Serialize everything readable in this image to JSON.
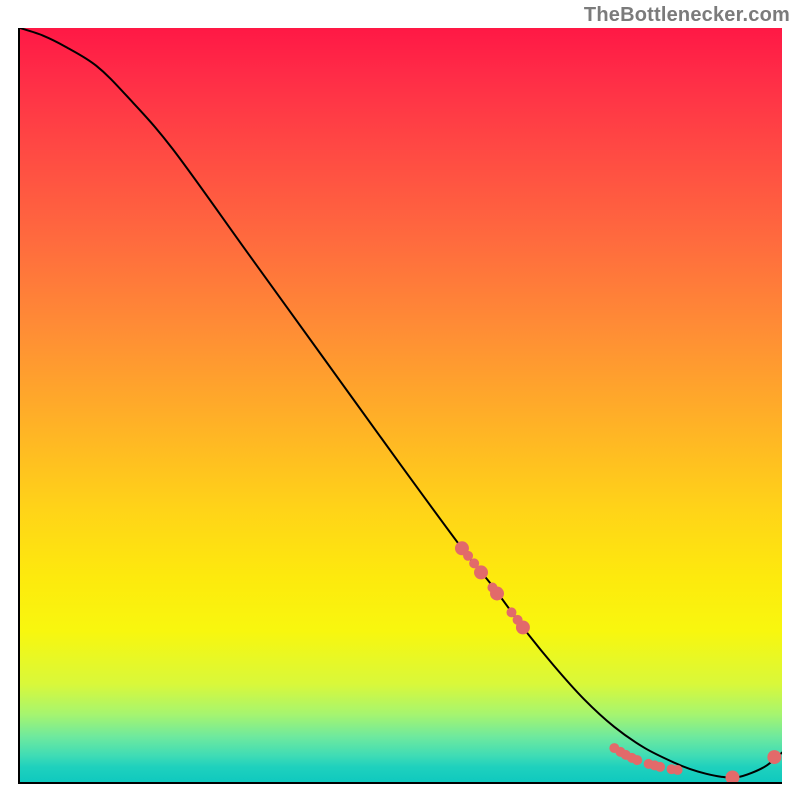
{
  "attribution": "TheBottlenecker.com",
  "chart_data": {
    "type": "line",
    "title": "",
    "xlabel": "",
    "ylabel": "",
    "xlim": [
      0,
      100
    ],
    "ylim": [
      0,
      100
    ],
    "background_gradient": {
      "direction": "vertical",
      "stops": [
        {
          "pos": 0,
          "color": "#ff1845"
        },
        {
          "pos": 50,
          "color": "#ffb027"
        },
        {
          "pos": 80,
          "color": "#f8f70e"
        },
        {
          "pos": 100,
          "color": "#0fc9bf"
        }
      ]
    },
    "series": [
      {
        "name": "bottleneck-curve",
        "x": [
          0,
          3,
          6,
          10,
          14,
          20,
          30,
          40,
          50,
          58,
          62,
          66,
          70,
          74,
          78,
          82,
          86,
          88,
          90,
          92,
          94,
          96,
          98,
          100
        ],
        "y": [
          100,
          99,
          97.5,
          95,
          91,
          84,
          70,
          56,
          42,
          31,
          26,
          20.5,
          15.5,
          11,
          7.3,
          4.5,
          2.5,
          1.7,
          1.1,
          0.7,
          0.6,
          1.2,
          2.2,
          3.9
        ]
      }
    ],
    "scatter_points": {
      "name": "marker-points",
      "color": "#e26a6a",
      "radius_small": 5,
      "radius_large": 7,
      "points": [
        {
          "x": 58.0,
          "y": 31.0,
          "r": "large"
        },
        {
          "x": 58.8,
          "y": 30.0,
          "r": "small"
        },
        {
          "x": 59.6,
          "y": 29.0,
          "r": "small"
        },
        {
          "x": 60.5,
          "y": 27.8,
          "r": "large"
        },
        {
          "x": 62.0,
          "y": 25.8,
          "r": "small"
        },
        {
          "x": 62.6,
          "y": 25.0,
          "r": "large"
        },
        {
          "x": 64.5,
          "y": 22.5,
          "r": "small"
        },
        {
          "x": 65.3,
          "y": 21.5,
          "r": "small"
        },
        {
          "x": 66.0,
          "y": 20.5,
          "r": "large"
        },
        {
          "x": 78.0,
          "y": 4.5,
          "r": "small"
        },
        {
          "x": 78.8,
          "y": 4.0,
          "r": "small"
        },
        {
          "x": 79.5,
          "y": 3.6,
          "r": "small"
        },
        {
          "x": 80.3,
          "y": 3.2,
          "r": "small"
        },
        {
          "x": 81.0,
          "y": 2.9,
          "r": "small"
        },
        {
          "x": 82.5,
          "y": 2.4,
          "r": "small"
        },
        {
          "x": 83.3,
          "y": 2.2,
          "r": "small"
        },
        {
          "x": 84.0,
          "y": 2.0,
          "r": "small"
        },
        {
          "x": 85.5,
          "y": 1.7,
          "r": "small"
        },
        {
          "x": 86.3,
          "y": 1.6,
          "r": "small"
        },
        {
          "x": 93.5,
          "y": 0.6,
          "r": "large"
        },
        {
          "x": 99.0,
          "y": 3.3,
          "r": "large"
        }
      ]
    }
  }
}
